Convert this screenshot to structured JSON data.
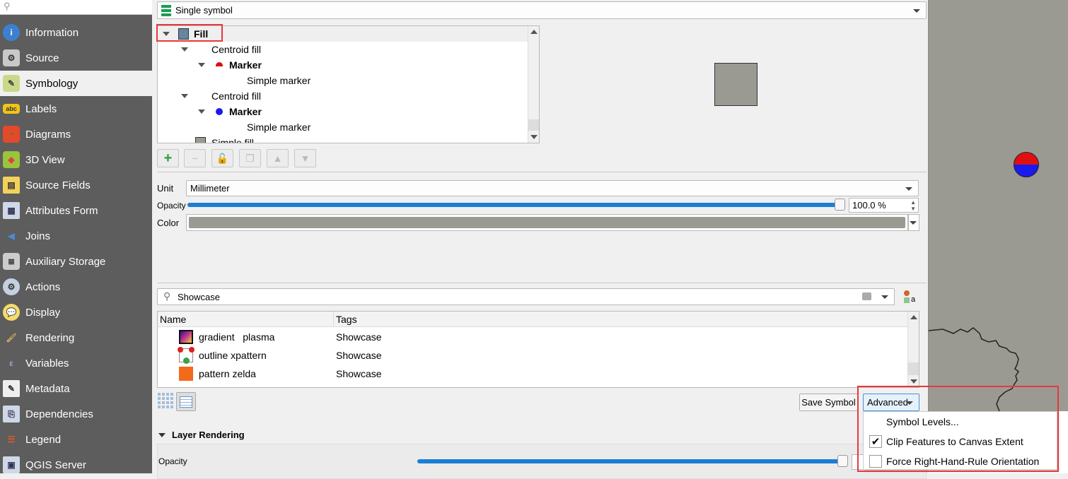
{
  "sidebar": {
    "search_placeholder": "",
    "items": [
      {
        "label": "Information",
        "icon": "info-icon"
      },
      {
        "label": "Source",
        "icon": "source-icon"
      },
      {
        "label": "Symbology",
        "icon": "symbology-icon",
        "selected": true
      },
      {
        "label": "Labels",
        "icon": "labels-icon"
      },
      {
        "label": "Diagrams",
        "icon": "diagrams-icon"
      },
      {
        "label": "3D View",
        "icon": "3d-view-icon"
      },
      {
        "label": "Source Fields",
        "icon": "source-fields-icon"
      },
      {
        "label": "Attributes Form",
        "icon": "attributes-form-icon"
      },
      {
        "label": "Joins",
        "icon": "joins-icon"
      },
      {
        "label": "Auxiliary Storage",
        "icon": "auxiliary-storage-icon"
      },
      {
        "label": "Actions",
        "icon": "actions-icon"
      },
      {
        "label": "Display",
        "icon": "display-icon"
      },
      {
        "label": "Rendering",
        "icon": "rendering-icon"
      },
      {
        "label": "Variables",
        "icon": "variables-icon"
      },
      {
        "label": "Metadata",
        "icon": "metadata-icon"
      },
      {
        "label": "Dependencies",
        "icon": "dependencies-icon"
      },
      {
        "label": "Legend",
        "icon": "legend-icon"
      },
      {
        "label": "QGIS Server",
        "icon": "qgis-server-icon"
      }
    ]
  },
  "renderer": {
    "selected": "Single symbol"
  },
  "tree": {
    "rows": [
      {
        "label": "Fill",
        "bold": true
      },
      {
        "label": "Centroid fill"
      },
      {
        "label": "Marker",
        "bold": true
      },
      {
        "label": "Simple marker"
      },
      {
        "label": "Centroid fill"
      },
      {
        "label": "Marker",
        "bold": true
      },
      {
        "label": "Simple marker"
      },
      {
        "label": "Simple fill"
      }
    ]
  },
  "props": {
    "unit_label": "Unit",
    "unit_value": "Millimeter",
    "opacity_label": "Opacity",
    "opacity_value": "100.0 %",
    "opacity_percent": 100,
    "color_label": "Color",
    "color": "#9a9a92"
  },
  "library": {
    "search_value": "Showcase",
    "col_name": "Name",
    "col_tags": "Tags",
    "rows": [
      {
        "name": "gradient   plasma",
        "tags": "Showcase"
      },
      {
        "name": "outline xpattern",
        "tags": "Showcase"
      },
      {
        "name": "pattern zelda",
        "tags": "Showcase"
      }
    ]
  },
  "buttons": {
    "save_symbol": "Save Symbol",
    "advanced": "Advanced"
  },
  "advanced_menu": [
    {
      "label": "Symbol Levels..."
    },
    {
      "label": "Clip Features to Canvas Extent",
      "checked": true
    },
    {
      "label": "Force Right-Hand-Rule Orientation",
      "checked": false
    }
  ],
  "layer_rendering": {
    "title": "Layer Rendering",
    "opacity_label": "Opacity",
    "opacity_percent": 100
  },
  "colors": {
    "highlight": "#e8383d",
    "map_bg": "#9a9a92",
    "slider": "#1a7fd4"
  }
}
